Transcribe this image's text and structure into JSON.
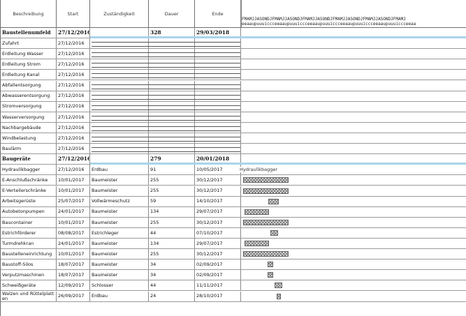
{
  "header": {
    "col_name": "Beschreibung",
    "col_start": "Start",
    "col_resp": "Zuständigkeit",
    "col_dur": "Dauer",
    "col_end": "Ende",
    "timeline_top": "FMAMJJASONDJFMAMJJASONDJFMAMJJASONDJFMAMJJASONDJFMAMJJASONDJFMAMJ",
    "timeline_bottom": "eeaaupuuuiccceeaaupuuuiccceeaaupuuuiccceeaaupuuuiccceeaaupuuuiccceeaa"
  },
  "groups": [
    {
      "name": "Baustellenumfeld",
      "start": "27/12/2016",
      "dur": "328",
      "end": "29/03/2018",
      "rows": [
        {
          "name": "Zufahrt",
          "start": "27/12/2016"
        },
        {
          "name": "Erdleitung Wasser",
          "start": "27/12/2016"
        },
        {
          "name": "Erdleitung Strom",
          "start": "27/12/2016"
        },
        {
          "name": "Erdleitung Kanal",
          "start": "27/12/2016"
        },
        {
          "name": "Abfallentsorgung",
          "start": "27/12/2016"
        },
        {
          "name": "Abwasserentsorgung",
          "start": "27/12/2016"
        },
        {
          "name": "Stromversorgung",
          "start": "27/12/2016"
        },
        {
          "name": "Wasserversorgung",
          "start": "27/12/2016"
        },
        {
          "name": "Nachbargebäude",
          "start": "27/12/2016"
        },
        {
          "name": "Windbelastung",
          "start": "27/12/2016"
        },
        {
          "name": "Baulärm",
          "start": "27/12/2016"
        }
      ]
    },
    {
      "name": "Baugeräte",
      "start": "27/12/2016",
      "dur": "279",
      "end": "20/01/2018",
      "rows": [
        {
          "name": "Hydraulikbagger",
          "start": "27/12/2016",
          "resp": "Erdbau",
          "dur": "91",
          "end": "10/05/2017",
          "bar_label": "Hydraulikbagger"
        },
        {
          "name": "E-Anschlußschränke",
          "start": "10/01/2017",
          "resp": "Baumeister",
          "dur": "255",
          "end": "30/12/2017"
        },
        {
          "name": "E-Verteilerschränke",
          "start": "10/01/2017",
          "resp": "Baumeister",
          "dur": "255",
          "end": "30/12/2017"
        },
        {
          "name": "Arbeitsgerüste",
          "start": "25/07/2017",
          "resp": "Vollwärmeschutz",
          "dur": "59",
          "end": "14/10/2017"
        },
        {
          "name": "Autobetonpumpen",
          "start": "24/01/2017",
          "resp": "Baumeister",
          "dur": "134",
          "end": "29/07/2017"
        },
        {
          "name": "Baucontainer",
          "start": "10/01/2017",
          "resp": "Baumeister",
          "dur": "255",
          "end": "30/12/2017"
        },
        {
          "name": "Estrichförderer",
          "start": "08/08/2017",
          "resp": "Estrichleger",
          "dur": "44",
          "end": "07/10/2017"
        },
        {
          "name": "Turmdrehkran",
          "start": "24/01/2017",
          "resp": "Baumeister",
          "dur": "134",
          "end": "29/07/2017"
        },
        {
          "name": "Baustelleneinrichtung",
          "start": "10/01/2017",
          "resp": "Baumeister",
          "dur": "255",
          "end": "30/12/2017"
        },
        {
          "name": "Baustoff-Silos",
          "start": "18/07/2017",
          "resp": "Baumeister",
          "dur": "34",
          "end": "02/09/2017"
        },
        {
          "name": "Verputzmaschinen",
          "start": "18/07/2017",
          "resp": "Baumeister",
          "dur": "34",
          "end": "02/09/2017"
        },
        {
          "name": "Schweißgeräte",
          "start": "12/09/2017",
          "resp": "Schlosser",
          "dur": "44",
          "end": "11/11/2017"
        },
        {
          "name": "Walzen und Rüttelplatten",
          "start": "26/09/2017",
          "resp": "Erdbau",
          "dur": "24",
          "end": "28/10/2017"
        }
      ]
    }
  ]
}
